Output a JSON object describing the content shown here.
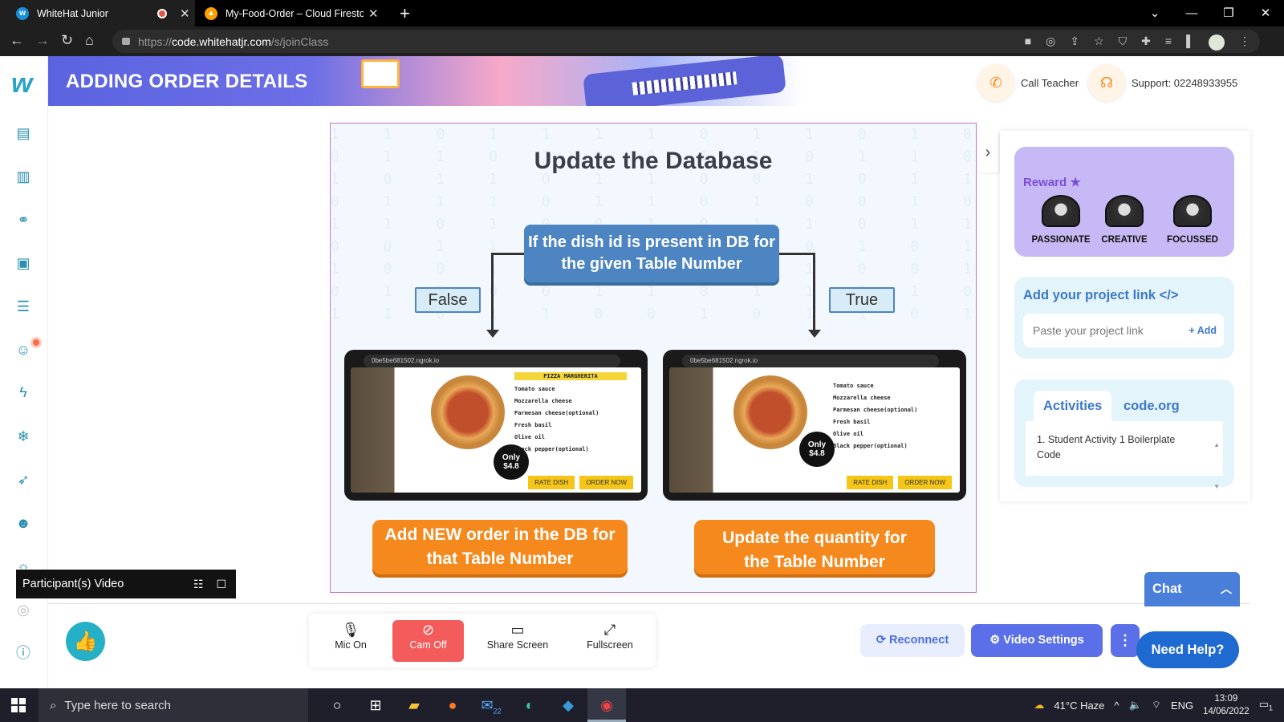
{
  "browser": {
    "tabs": [
      {
        "title": "WhiteHat Junior",
        "active": true
      },
      {
        "title": "My-Food-Order – Cloud Firestore",
        "active": false
      }
    ],
    "url_domain": "code.whitehatjr.com",
    "url_prefix": "https://",
    "url_path": "/s/joinClass"
  },
  "header": {
    "banner_title": "ADDING ORDER DETAILS",
    "call_teacher": "Call Teacher",
    "support": "Support: 02248933955"
  },
  "slide": {
    "title": "Update the Database",
    "condition": "If the dish id is present in DB for the given Table Number",
    "false_label": "False",
    "true_label": "True",
    "left_phone": {
      "url": "0be5be681502.ngrok.io",
      "dish_title": "PIZZA MARGHERITA",
      "badge_line1": "Only",
      "badge_line2": "$4.8",
      "ingredients": [
        "Tomato sauce",
        "Mozzarella cheese",
        "Parmesan cheese(optional)",
        "Fresh basil",
        "Olive oil",
        "Black pepper(optional)"
      ],
      "rate_btn": "RATE DISH",
      "order_btn": "ORDER NOW"
    },
    "right_phone": {
      "url": "0be5be681502.ngrok.io",
      "badge_line1": "Only",
      "badge_line2": "$4.8",
      "ingredients": [
        "Tomato sauce",
        "Mozzarella cheese",
        "Parmesan cheese(optional)",
        "Fresh basil",
        "Olive oil",
        "Black pepper(optional)"
      ],
      "rate_btn": "RATE DISH",
      "order_btn": "ORDER NOW"
    },
    "left_action": "Add NEW order in the DB for that Table Number",
    "right_action": "Update the quantity for the Table Number"
  },
  "right_panel": {
    "reward_label": "Reward",
    "badges": [
      "PASSIONATE",
      "CREATIVE",
      "FOCUSSED"
    ],
    "project_link_label": "Add your project link </>",
    "project_link_placeholder": "Paste your project link",
    "add_label": "+ Add",
    "tabs": [
      "Activities",
      "code.org"
    ],
    "activities": [
      "1. Student Activity 1 Boilerplate Code"
    ]
  },
  "participant_video": "Participant(s) Video",
  "controls": {
    "mic": "Mic On",
    "cam": "Cam Off",
    "share": "Share Screen",
    "fullscreen": "Fullscreen"
  },
  "reconnect": "Reconnect",
  "video_settings": "Video Settings",
  "chat": "Chat",
  "need_help": "Need Help?",
  "taskbar": {
    "search_placeholder": "Type here to search",
    "weather": "41°C  Haze",
    "language": "ENG",
    "time": "13:09",
    "date": "14/06/2022",
    "mail_count": "22",
    "notif_count": "1"
  },
  "colors": {
    "accent_blue": "#4d85c2",
    "orange": "#f5891d",
    "cam_off_red": "#f45c5c",
    "video_settings_blue": "#5b6fe8"
  }
}
